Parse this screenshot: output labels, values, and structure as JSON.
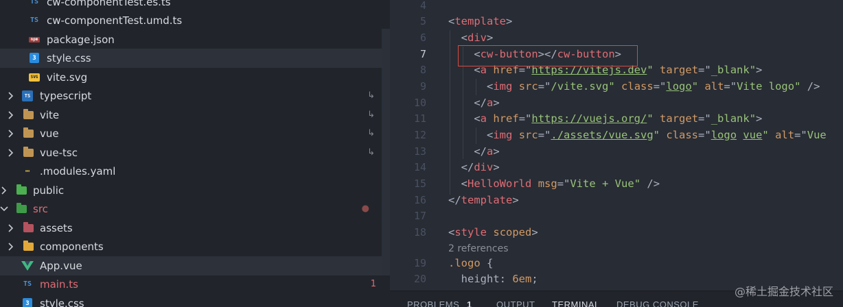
{
  "explorer": {
    "items": [
      {
        "name": "cw-componentTest.es.ts",
        "icon": "typescript-file-icon",
        "color": "#d7dae0"
      },
      {
        "name": "cw-componentTest.umd.ts",
        "icon": "typescript-file-icon",
        "color": "#d7dae0"
      },
      {
        "name": "package.json",
        "icon": "json-file-icon",
        "color": "#d7dae0"
      },
      {
        "name": "style.css",
        "icon": "css-file-icon",
        "color": "#d7dae0"
      },
      {
        "name": "vite.svg",
        "icon": "svg-file-icon",
        "color": "#d7dae0"
      },
      {
        "name": "typescript",
        "icon": "typescript-folder-icon",
        "color": "#d7dae0",
        "mark": "↳"
      },
      {
        "name": "vite",
        "icon": "folder-icon",
        "color": "#d7dae0",
        "mark": "↳"
      },
      {
        "name": "vue",
        "icon": "folder-icon",
        "color": "#d7dae0",
        "mark": "↳"
      },
      {
        "name": "vue-tsc",
        "icon": "folder-icon",
        "color": "#d7dae0",
        "mark": "↳"
      },
      {
        "name": ".modules.yaml",
        "icon": "yaml-file-icon",
        "color": "#d7dae0"
      },
      {
        "name": "public",
        "icon": "public-folder-icon",
        "color": "#d7dae0"
      },
      {
        "name": "src",
        "icon": "src-folder-icon",
        "color": "#e06c75",
        "mark": "●"
      },
      {
        "name": "assets",
        "icon": "assets-folder-icon",
        "color": "#d7dae0"
      },
      {
        "name": "components",
        "icon": "components-folder-icon",
        "color": "#d7dae0"
      },
      {
        "name": "App.vue",
        "icon": "vue-file-icon",
        "color": "#d7dae0"
      },
      {
        "name": "main.ts",
        "icon": "typescript-file-icon",
        "color": "#e06c75",
        "mark": "1"
      },
      {
        "name": "style.css",
        "icon": "css-file-icon",
        "color": "#d7dae0"
      }
    ]
  },
  "editor": {
    "line_numbers": [
      "4",
      "5",
      "6",
      "7",
      "8",
      "9",
      "10",
      "11",
      "12",
      "13",
      "14",
      "15",
      "16",
      "17",
      "18",
      "19",
      "20"
    ],
    "active_line": "7",
    "references_label": "2 references",
    "code": {
      "l5_tag": "template",
      "l6_tag": "div",
      "l7_tag": "cw-button",
      "l8_tag": "a",
      "l8_attr1": "href",
      "l8_val1": "https://vitejs.dev",
      "l8_attr2": "target",
      "l8_val2": "_blank",
      "l9_tag": "img",
      "l9_attr1": "src",
      "l9_val1": "/vite.svg",
      "l9_attr2": "class",
      "l9_val2": "logo",
      "l9_attr3": "alt",
      "l9_val3": "Vite logo",
      "l10_tag": "a",
      "l11_tag": "a",
      "l11_attr1": "href",
      "l11_val1": "https://vuejs.org/",
      "l11_attr2": "target",
      "l11_val2": "_blank",
      "l12_tag": "img",
      "l12_attr1": "src",
      "l12_val1": "./assets/vue.svg",
      "l12_attr2": "class",
      "l12_val2a": "logo",
      "l12_val2b": "vue",
      "l12_attr3": "alt",
      "l12_val3": "Vue",
      "l13_tag": "a",
      "l14_tag": "div",
      "l15_tag": "HelloWorld",
      "l15_attr": "msg",
      "l15_val": "Vite + Vue",
      "l16_tag": "template",
      "l18_tag": "style",
      "l18_attr": "scoped",
      "l19_selector": ".logo",
      "l20_prop": "height",
      "l20_val": "6em"
    }
  },
  "panel": {
    "tabs": [
      "PROBLEMS",
      "1",
      "OUTPUT",
      "TERMINAL",
      "DEBUG CONSOLE"
    ],
    "active_tab": "TERMINAL"
  },
  "watermark": "@稀土掘金技术社区"
}
